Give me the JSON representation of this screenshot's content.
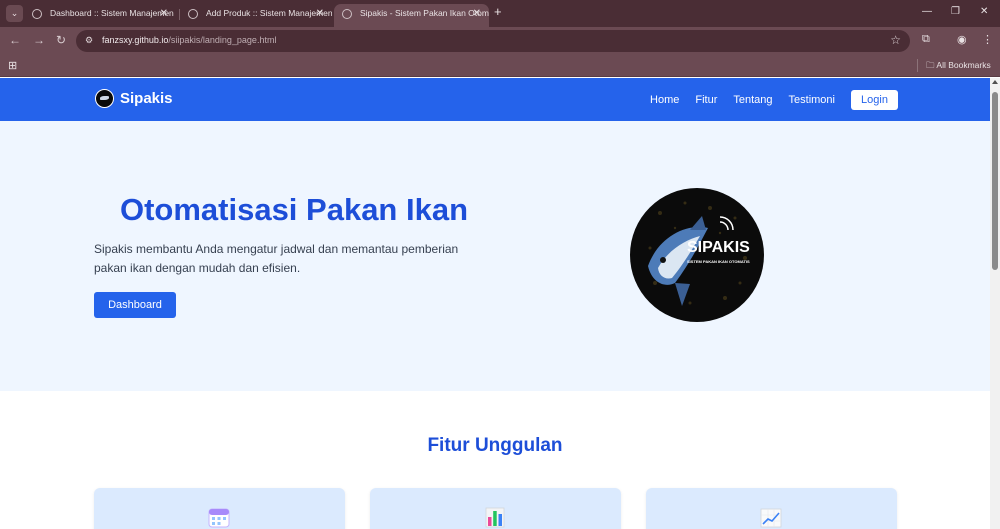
{
  "browser": {
    "tabs": [
      {
        "label": "Dashboard :: Sistem Manajemen",
        "active": false
      },
      {
        "label": "Add Produk :: Sistem Manajemen",
        "active": false
      },
      {
        "label": "Sipakis - Sistem Pakan Ikan Otomatis",
        "active": true
      }
    ],
    "url_host": "fanzsxy.github.io",
    "url_path": "/siipakis/landing_page.html",
    "bookmarks_label": "All Bookmarks"
  },
  "nav": {
    "brand": "Sipakis",
    "links": [
      "Home",
      "Fitur",
      "Tentang",
      "Testimoni"
    ],
    "login": "Login"
  },
  "hero": {
    "title": "Otomatisasi Pakan Ikan",
    "description": "Sipakis membantu Anda mengatur jadwal dan memantau pemberian pakan ikan dengan mudah dan efisien.",
    "button": "Dashboard",
    "logo_text": "SIPAKIS",
    "logo_subtext": "SISTEM PAKAN IKAN OTOMATIS"
  },
  "features": {
    "title": "Fitur Unggulan",
    "cards": [
      {
        "icon": "calendar-icon"
      },
      {
        "icon": "bar-chart-icon"
      },
      {
        "icon": "trend-chart-icon"
      }
    ]
  },
  "colors": {
    "primary": "#2563eb",
    "title": "#1d4ed8",
    "hero_bg": "#eff6ff",
    "card_bg": "#dbeafe"
  }
}
